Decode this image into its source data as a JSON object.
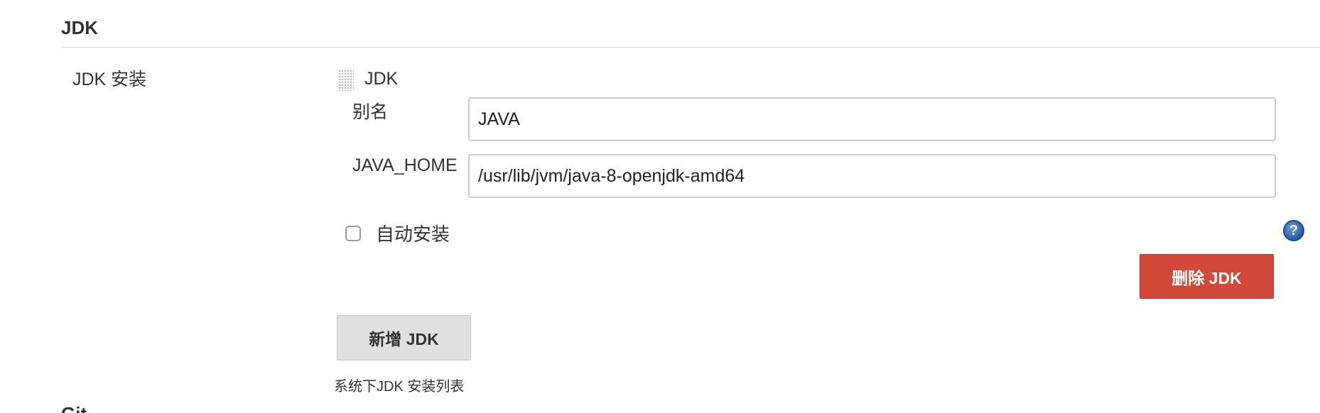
{
  "section": {
    "title": "JDK",
    "next_title": "Git"
  },
  "jdk_installations": {
    "label": "JDK 安装",
    "item_title": "JDK",
    "alias_label": "别名",
    "alias_value": "JAVA",
    "java_home_label": "JAVA_HOME",
    "java_home_value": "/usr/lib/jvm/java-8-openjdk-amd64",
    "auto_install_label": "自动安装",
    "auto_install_checked": false,
    "help_glyph": "?",
    "delete_button": "删除 JDK",
    "add_button": "新增 JDK",
    "description": "系统下JDK 安装列表"
  },
  "icons": {
    "drag_handle": "drag-handle-icon",
    "help": "help-icon"
  },
  "colors": {
    "delete_button": "#d24939",
    "add_button": "#e0e0e0",
    "help_icon": "#2b5aa6"
  }
}
